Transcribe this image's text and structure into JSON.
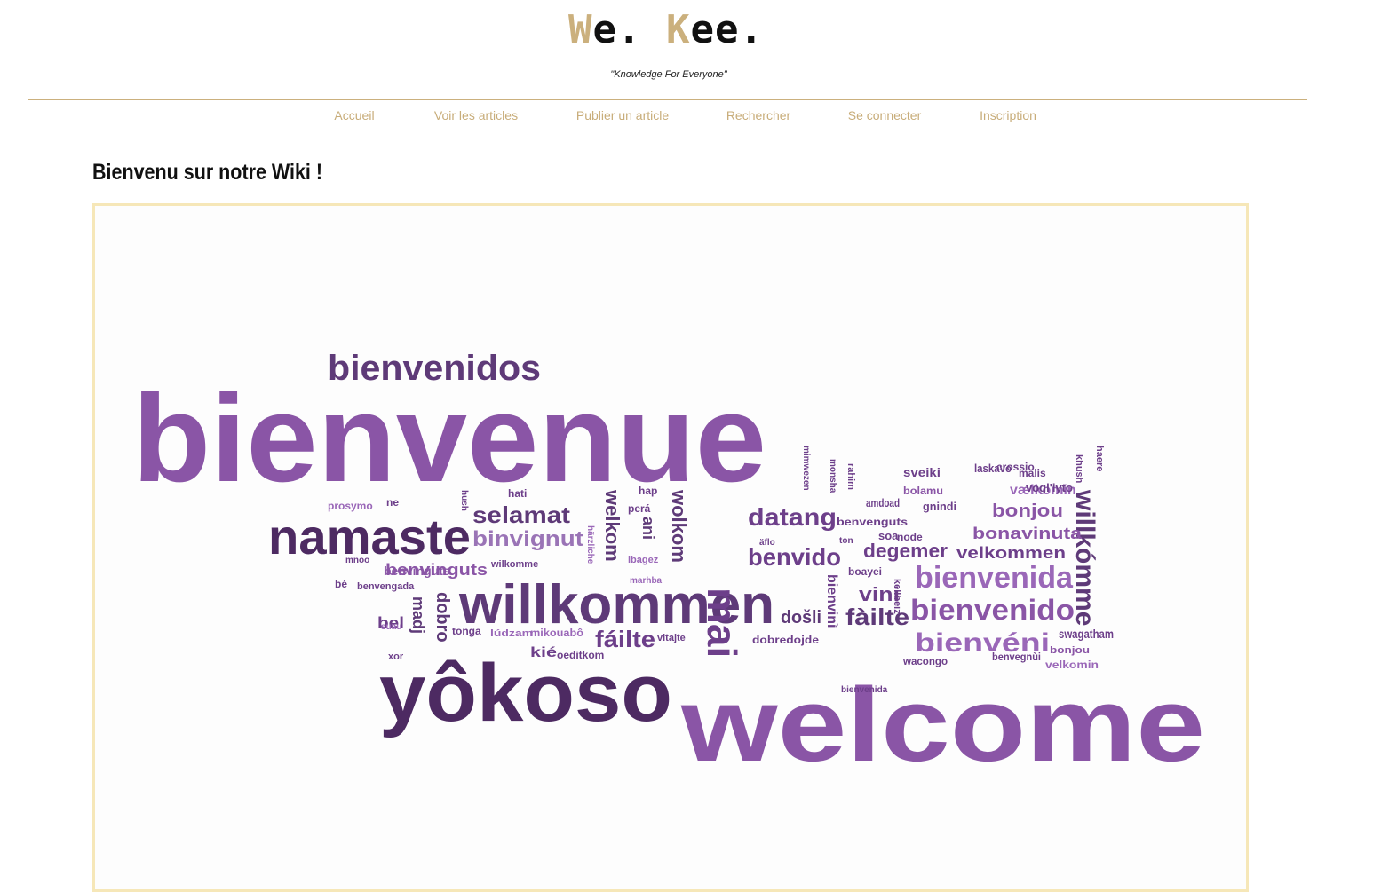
{
  "header": {
    "logo": {
      "part1": "W",
      "part2": "e. ",
      "part3": "K",
      "part4": "ee.",
      "accent_color": "#cbb07d"
    },
    "tagline": "\"Knowledge For Everyone\""
  },
  "nav": [
    {
      "label": "Accueil"
    },
    {
      "label": "Voir les articles"
    },
    {
      "label": "Publier un article"
    },
    {
      "label": "Rechercher"
    },
    {
      "label": "Se connecter"
    },
    {
      "label": "Inscription"
    }
  ],
  "main": {
    "heading": "Bienvenu sur notre Wiki !",
    "banner_words": [
      {
        "t": "bienvenue",
        "c": "#8a55a6"
      },
      {
        "t": "bienvenidos",
        "c": "#5e3a78"
      },
      {
        "t": "welcome",
        "c": "#8a55a6"
      },
      {
        "t": "yôkoso",
        "c": "#4d2a62"
      },
      {
        "t": "namaste",
        "c": "#4d2a62"
      },
      {
        "t": "willkommen",
        "c": "#5e3a78"
      },
      {
        "t": "mai",
        "c": "#6d3f8a"
      },
      {
        "t": "datang",
        "c": "#6d3f8a"
      },
      {
        "t": "selamat",
        "c": "#5e3a78"
      },
      {
        "t": "binvignut",
        "c": "#9a74b6"
      },
      {
        "t": "benvido",
        "c": "#6d3f8a"
      },
      {
        "t": "bienvenida",
        "c": "#9a67b8"
      },
      {
        "t": "bienvenido",
        "c": "#8a55a6"
      },
      {
        "t": "bienvéni",
        "c": "#9a67b8"
      },
      {
        "t": "fáilte",
        "c": "#6d3f8a"
      },
      {
        "t": "fàilte",
        "c": "#5e3a78"
      },
      {
        "t": "willkómme",
        "c": "#5e3a78"
      },
      {
        "t": "bonjou",
        "c": "#8a55a6"
      },
      {
        "t": "bonavinuta",
        "c": "#8a55a6"
      },
      {
        "t": "velkommen",
        "c": "#6d3f8a"
      },
      {
        "t": "degemer",
        "c": "#6d3f8a"
      },
      {
        "t": "vini",
        "c": "#6d3f8a"
      },
      {
        "t": "došli",
        "c": "#5e3a78"
      },
      {
        "t": "benvinguts",
        "c": "#8a55a6"
      },
      {
        "t": "welkom",
        "c": "#5e3a78"
      },
      {
        "t": "wolkom",
        "c": "#5e3a78"
      },
      {
        "t": "dobro",
        "c": "#5e3a78"
      },
      {
        "t": "bel",
        "c": "#6d3f8a"
      },
      {
        "t": "madj",
        "c": "#5e3a78"
      },
      {
        "t": "kié",
        "c": "#6d3f8a"
      },
      {
        "t": "ani",
        "c": "#5e3a78"
      },
      {
        "t": "bienvinì",
        "c": "#6d3f8a"
      },
      {
        "t": "swagatham",
        "c": "#6d3f8a"
      },
      {
        "t": "bonjou",
        "c": "#8a55a6"
      },
      {
        "t": "velkomin",
        "c": "#9a67b8"
      },
      {
        "t": "vælkomin",
        "c": "#9a67b8"
      },
      {
        "t": "benvegnùi",
        "c": "#6d3f8a"
      },
      {
        "t": "wacongo",
        "c": "#6d3f8a"
      },
      {
        "t": "dobredojde",
        "c": "#6d3f8a"
      },
      {
        "t": "sveiki",
        "c": "#6d3f8a"
      },
      {
        "t": "laskavo",
        "c": "#6d3f8a"
      },
      {
        "t": "crossio",
        "c": "#6d3f8a"
      },
      {
        "t": "malis",
        "c": "#6d3f8a"
      },
      {
        "t": "vogl'iyto",
        "c": "#6d3f8a"
      },
      {
        "t": "bolamu",
        "c": "#8a55a6"
      },
      {
        "t": "amdoad",
        "c": "#6d3f8a"
      },
      {
        "t": "gnindi",
        "c": "#6d3f8a"
      },
      {
        "t": "benvenguts",
        "c": "#6d3f8a"
      },
      {
        "t": "soa",
        "c": "#6d3f8a"
      },
      {
        "t": "node",
        "c": "#6d3f8a"
      },
      {
        "t": "boayei",
        "c": "#6d3f8a"
      },
      {
        "t": "tonga",
        "c": "#6d3f8a"
      },
      {
        "t": "lúdzam",
        "c": "#9a67b8"
      },
      {
        "t": "mikouabô",
        "c": "#9a67b8"
      },
      {
        "t": "oeditkom",
        "c": "#6d3f8a"
      },
      {
        "t": "vitajte",
        "c": "#6d3f8a"
      },
      {
        "t": "wilkomme",
        "c": "#6d3f8a"
      },
      {
        "t": "marhba",
        "c": "#9a67b8"
      },
      {
        "t": "benvinguts",
        "c": "#8a55a6"
      },
      {
        "t": "benvengada",
        "c": "#6d3f8a"
      },
      {
        "t": "prosymo",
        "c": "#9a67b8"
      },
      {
        "t": "ne",
        "c": "#6d3f8a"
      },
      {
        "t": "hati",
        "c": "#6d3f8a"
      },
      {
        "t": "hap",
        "c": "#6d3f8a"
      },
      {
        "t": "perá",
        "c": "#6d3f8a"
      },
      {
        "t": "ibagez",
        "c": "#9a67b8"
      },
      {
        "t": "härzliche",
        "c": "#9a67b8"
      },
      {
        "t": "kellbeiz",
        "c": "#6d3f8a"
      },
      {
        "t": "xor",
        "c": "#6d3f8a"
      },
      {
        "t": "suau",
        "c": "#9a67b8"
      },
      {
        "t": "mnoo",
        "c": "#6d3f8a"
      },
      {
        "t": "ton",
        "c": "#6d3f8a"
      },
      {
        "t": "äflo",
        "c": "#6d3f8a"
      },
      {
        "t": "khush",
        "c": "#6d3f8a"
      },
      {
        "t": "haere",
        "c": "#6d3f8a"
      },
      {
        "t": "rahim",
        "c": "#6d3f8a"
      },
      {
        "t": "monsha",
        "c": "#6d3f8a"
      },
      {
        "t": "mimwezen",
        "c": "#6d3f8a"
      },
      {
        "t": "hush",
        "c": "#6d3f8a"
      },
      {
        "t": "bé",
        "c": "#6d3f8a"
      },
      {
        "t": "bienvenida",
        "c": "#6d3f8a"
      }
    ]
  }
}
